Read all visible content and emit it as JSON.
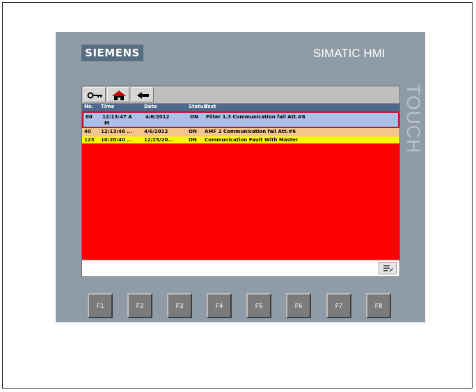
{
  "brand": "SIEMENS",
  "model": "SIMATIC HMI",
  "side_label": "TOUCH",
  "toolbar": {
    "buttons": [
      {
        "icon": "key-icon"
      },
      {
        "icon": "home-icon"
      },
      {
        "icon": "back-arrow-icon"
      }
    ]
  },
  "alarm_table": {
    "columns": [
      "No.",
      "Time",
      "Date",
      "Status",
      "Text"
    ],
    "rows": [
      {
        "no": "60",
        "time": "12:13:47 A",
        "time_wrap": "M",
        "date": "4/6/2012",
        "status": "ON",
        "text": "Filter 1.3 Communication fail Att.#6",
        "state": "selected"
      },
      {
        "no": "40",
        "time": "12:13:46 ...",
        "date": "4/6/2012",
        "status": "ON",
        "text": "AMF 2 Communication fail Att.#6",
        "state": "warning"
      },
      {
        "no": "123",
        "time": "10:20:40 ...",
        "date": "12/25/20...",
        "status": "ON",
        "text": "Communication Fault With Master",
        "state": "alarm"
      }
    ]
  },
  "colors": {
    "screen_background": "#ff0000",
    "row_selected": "#a9c2e8",
    "row_warning": "#f6c58e",
    "row_alarm": "#ffff00",
    "header": "#4d6a8d",
    "panel": "#8f9ba7"
  },
  "bottom_bar": {
    "edit_icon": "edit-list-icon"
  },
  "function_keys": [
    "F1",
    "F2",
    "F3",
    "F4",
    "F5",
    "F6",
    "F7",
    "F8"
  ]
}
